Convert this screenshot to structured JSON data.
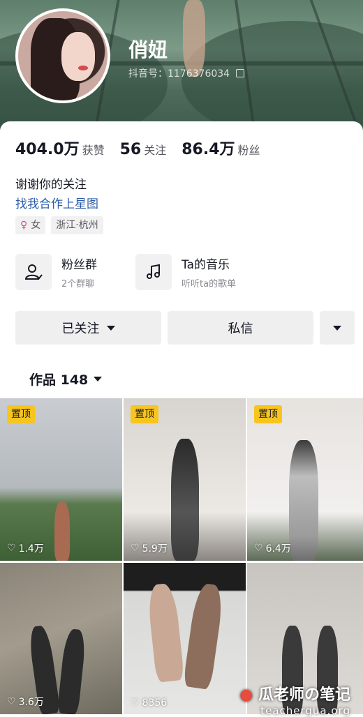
{
  "profile": {
    "nickname": "俏妞",
    "uid": "抖音号：1176376034",
    "bio": "谢谢你的关注",
    "business_link": "找我合作上星图",
    "tags": [
      {
        "label": "女",
        "icon": "female-icon"
      },
      {
        "label": "浙江·杭州"
      }
    ]
  },
  "stats": [
    {
      "value": "404.0万",
      "label": "获赞"
    },
    {
      "value": "56",
      "label": "关注"
    },
    {
      "value": "86.4万",
      "label": "粉丝"
    }
  ],
  "features": [
    {
      "title": "粉丝群",
      "subtitle": "2个群聊",
      "icon": "fan-group-icon"
    },
    {
      "title": "Ta的音乐",
      "subtitle": "听听ta的歌单",
      "icon": "music-note-icon"
    }
  ],
  "actions": {
    "follow_label": "已关注",
    "message_label": "私信"
  },
  "works": {
    "label": "作品 148"
  },
  "videos": [
    {
      "pinned": "置顶",
      "likes": "1.4万"
    },
    {
      "pinned": "置顶",
      "likes": "5.9万"
    },
    {
      "pinned": "置顶",
      "likes": "6.4万"
    },
    {
      "likes": "3.6万"
    },
    {
      "likes": "8356"
    },
    {
      "likes": ""
    }
  ],
  "watermark": {
    "title": "瓜老师の笔记",
    "site": "teachergua.org"
  },
  "colors": {
    "accent_link": "#2a5caa",
    "pin_badge": "#f7c51e",
    "female": "#e8457f"
  }
}
